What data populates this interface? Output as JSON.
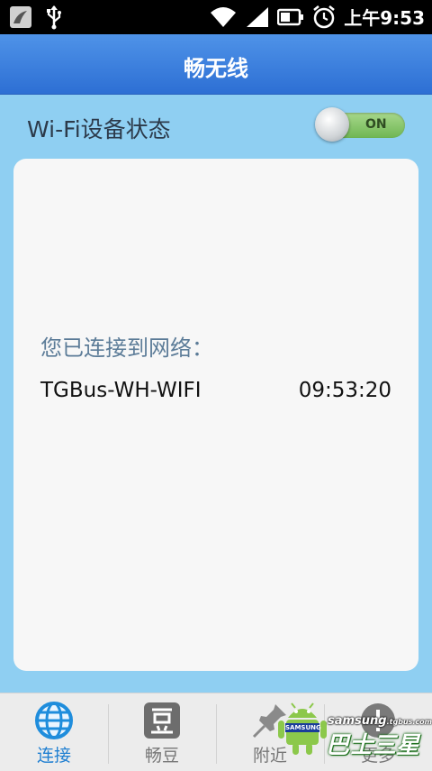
{
  "status_bar": {
    "time": "上午9:53"
  },
  "header": {
    "title": "畅无线"
  },
  "wifi_status": {
    "label": "Wi-Fi设备状态",
    "toggle_text": "ON"
  },
  "connection": {
    "connected_label": "您已连接到网络：",
    "network_name": "TGBus-WH-WIFI",
    "connected_time": "09:53:20"
  },
  "tabs": [
    {
      "label": "连接",
      "icon": "globe-icon",
      "active": true
    },
    {
      "label": "畅豆",
      "icon": "bean-icon",
      "active": false
    },
    {
      "label": "附近",
      "icon": "pin-icon",
      "active": false
    },
    {
      "label": "更多",
      "icon": "more-icon",
      "active": false
    }
  ],
  "watermark": {
    "site": "samsung",
    "domain": ".tgbus.com",
    "brand": "巴士三星",
    "badge": "SAMSUNG"
  },
  "colors": {
    "background": "#8fcff2",
    "header": "#3a7fdd",
    "active_tab": "#1f7fd1",
    "toggle_on": "#8cc970"
  }
}
